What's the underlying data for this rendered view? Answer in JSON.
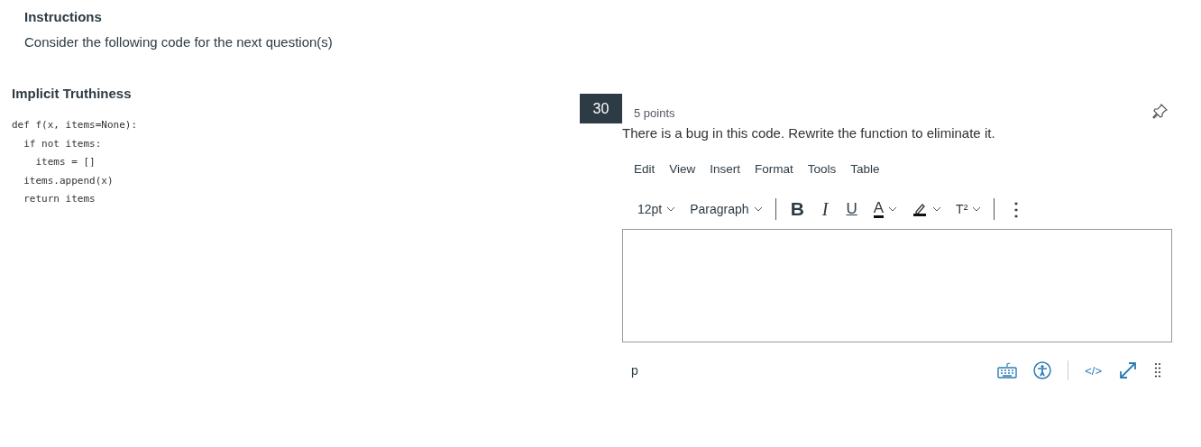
{
  "instructions": {
    "title": "Instructions",
    "text": "Consider the following code for the next question(s)"
  },
  "stimulus": {
    "title": "Implicit Truthiness",
    "code": [
      "def f(x, items=None):",
      "  if not items:",
      "    items = []",
      "  items.append(x)",
      "  return items"
    ]
  },
  "question": {
    "number": "30",
    "points": "5 points",
    "pinned": false,
    "text": "There is a bug in this code. Rewrite the function to eliminate it.",
    "editor": {
      "menus": [
        "Edit",
        "View",
        "Insert",
        "Format",
        "Tools",
        "Table"
      ],
      "font_size": "12pt",
      "block_format": "Paragraph",
      "format_buttons": [
        {
          "kind": "bold",
          "label": "B"
        },
        {
          "kind": "italic",
          "label": "I"
        },
        {
          "kind": "underline",
          "label": "U"
        },
        {
          "kind": "color",
          "label": "A"
        },
        {
          "kind": "highlight"
        },
        {
          "kind": "superscript",
          "label": "T²"
        }
      ],
      "more": "⋮",
      "path": "p",
      "html_label": "</>"
    }
  }
}
